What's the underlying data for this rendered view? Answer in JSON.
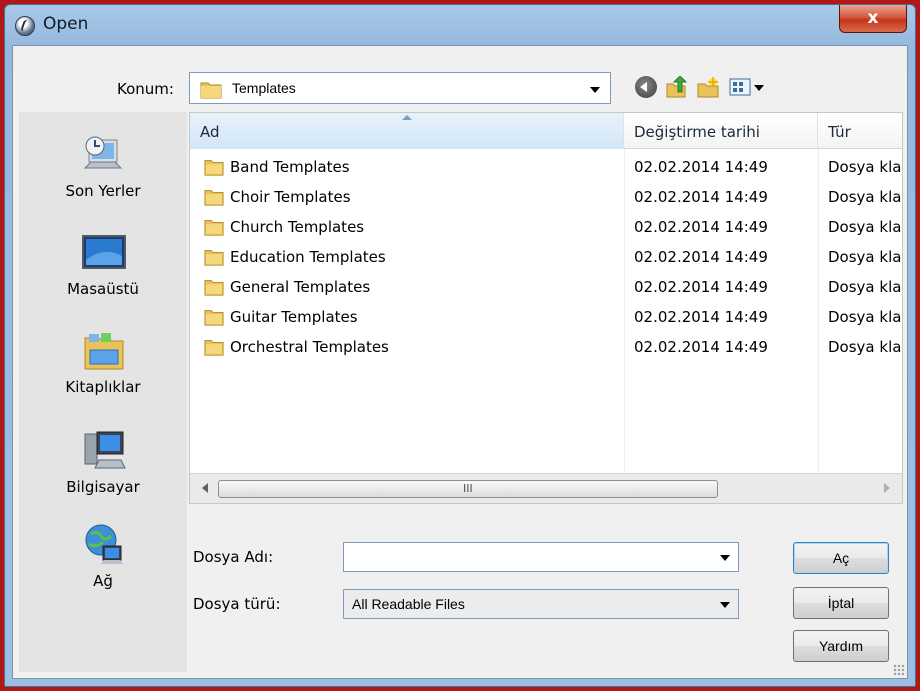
{
  "window": {
    "title": "Open",
    "close_label": "x"
  },
  "location": {
    "label": "Konum:",
    "value": "Templates"
  },
  "toolbar": {
    "icons": [
      "back-icon",
      "up-folder-icon",
      "new-folder-icon",
      "view-menu-icon"
    ]
  },
  "places": [
    {
      "label": "Son Yerler",
      "icon": "recent-places-icon"
    },
    {
      "label": "Masaüstü",
      "icon": "desktop-icon"
    },
    {
      "label": "Kitaplıklar",
      "icon": "libraries-icon"
    },
    {
      "label": "Bilgisayar",
      "icon": "computer-icon"
    },
    {
      "label": "Ağ",
      "icon": "network-icon"
    }
  ],
  "columns": {
    "name": "Ad",
    "date": "Değiştirme tarihi",
    "type": "Tür"
  },
  "files": [
    {
      "name": "Band Templates",
      "date": "02.02.2014 14:49",
      "type": "Dosya klasörü"
    },
    {
      "name": "Choir Templates",
      "date": "02.02.2014 14:49",
      "type": "Dosya klasörü"
    },
    {
      "name": "Church Templates",
      "date": "02.02.2014 14:49",
      "type": "Dosya klasörü"
    },
    {
      "name": "Education Templates",
      "date": "02.02.2014 14:49",
      "type": "Dosya klasörü"
    },
    {
      "name": "General Templates",
      "date": "02.02.2014 14:49",
      "type": "Dosya klasörü"
    },
    {
      "name": "Guitar Templates",
      "date": "02.02.2014 14:49",
      "type": "Dosya klasörü"
    },
    {
      "name": "Orchestral Templates",
      "date": "02.02.2014 14:49",
      "type": "Dosya klasörü"
    }
  ],
  "scrollbar": {
    "grip": "III"
  },
  "filename": {
    "label": "Dosya Adı:",
    "value": "",
    "placeholder": ""
  },
  "filetype": {
    "label": "Dosya türü:",
    "value": "All Readable Files"
  },
  "buttons": {
    "open": "Aç",
    "cancel": "İptal",
    "help": "Yardım"
  },
  "colors": {
    "frame": "#b01818",
    "title_bar": "#9cc0e4",
    "folder": "#e9c25a",
    "close": "#c1361b"
  }
}
